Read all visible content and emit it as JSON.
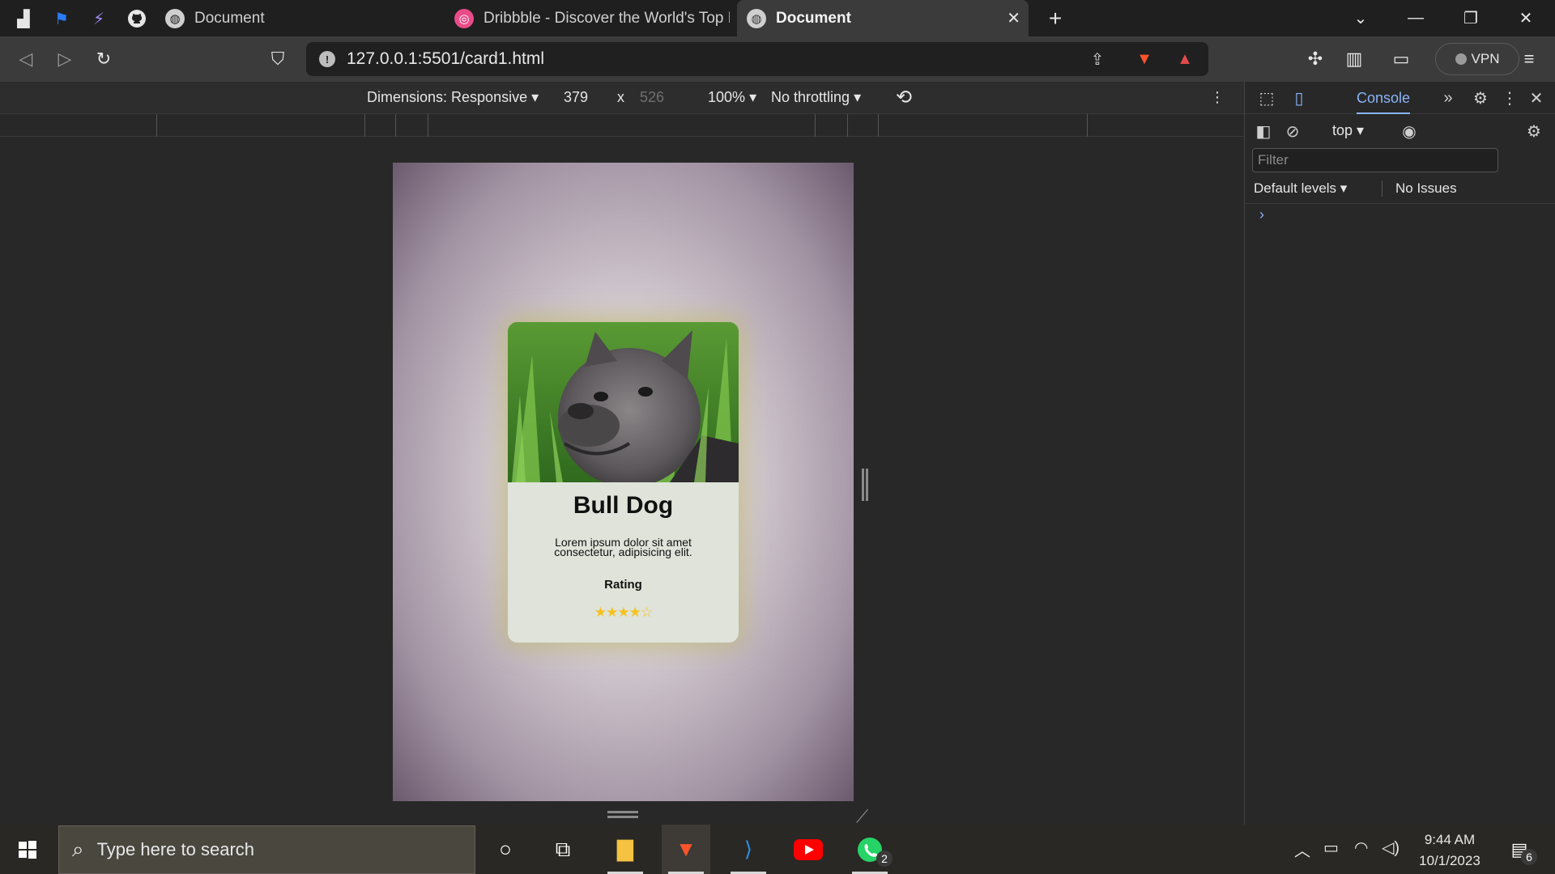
{
  "browser": {
    "tabs": [
      {
        "label": "Document",
        "active": false
      },
      {
        "label": "Dribbble - Discover the World's Top De",
        "active": false
      },
      {
        "label": "Document",
        "active": true
      }
    ],
    "new_tab_symbol": "+",
    "url_host": "127.0.0.1",
    "url_path": ":5501/card1.html",
    "vpn_label": "VPN"
  },
  "device_toolbar": {
    "dimensions_label": "Dimensions: Responsive",
    "width": "379",
    "separator": "x",
    "height": "526",
    "zoom": "100%",
    "throttling": "No throttling"
  },
  "card": {
    "title": "Bull Dog",
    "description": "Lorem ipsum dolor sit amet consectetur, adipisicing elit.",
    "rating_label": "Rating",
    "rating_value": 4.5,
    "stars_text": "★★★★☆"
  },
  "devtools": {
    "active_tab": "Console",
    "context": "top",
    "filter_placeholder": "Filter",
    "levels": "Default levels",
    "issues": "No Issues"
  },
  "taskbar": {
    "search_placeholder": "Type here to search",
    "time": "9:44 AM",
    "date": "10/1/2023",
    "whatsapp_badge": "2",
    "notification_badge": "6"
  }
}
